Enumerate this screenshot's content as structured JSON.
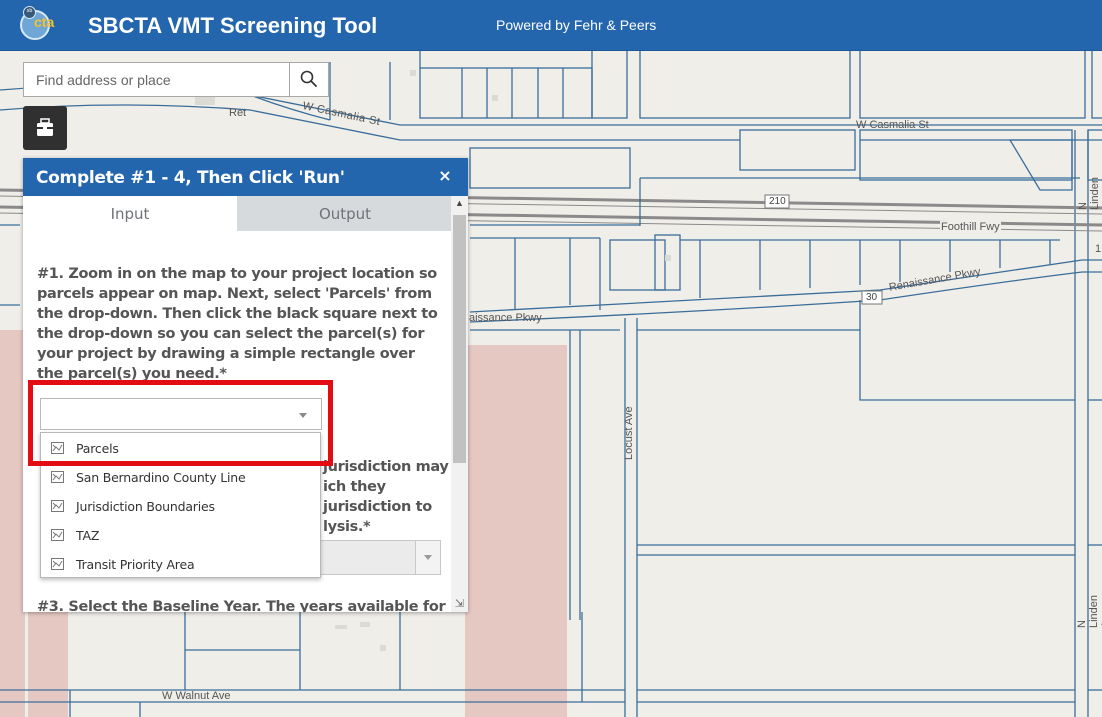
{
  "header": {
    "logo_text": "cta",
    "logo_small": "sb",
    "title": "SBCTA VMT Screening Tool",
    "subtitle": "Powered by Fehr & Peers"
  },
  "search": {
    "placeholder": "Find address or place",
    "value": ""
  },
  "toolbox": {
    "icon": "toolbox-icon"
  },
  "map": {
    "labels": {
      "casmalia_west": "W Casmalia St",
      "casmalia_east": "W Casmalia St",
      "ret": "Ret",
      "foothill": "Foothill Fwy",
      "route_210": "210",
      "route_30": "30",
      "renaissance_east": "Renaissance Pkwy",
      "renaissance_west": "aissance Pkwy",
      "locust": "Locust Ave",
      "linden_north": "N Linden Ave",
      "linden_south": "N Linden Ave",
      "walnut": "W Walnut Ave",
      "edge_1": "1"
    },
    "colors": {
      "background": "#f0eee9",
      "street": "#3a6d99",
      "freeway": "#7a7a7a",
      "zone": "#e7c9c4"
    }
  },
  "panel": {
    "title": "Complete #1 - 4, Then Click 'Run'",
    "close": "×",
    "tabs": [
      {
        "label": "Input",
        "active": true
      },
      {
        "label": "Output",
        "active": false
      }
    ],
    "step1": "#1. Zoom in on the map to your project location so parcels appear on map. Next, select 'Parcels' from the drop-down. Then click the black square next to the drop-down so you can select the parcel(s) for your project by drawing a simple rectangle over the parcel(s) you need.*",
    "layer_select_value": "",
    "step2_lines": [
      "jurisdiction may",
      "ich they",
      "jurisdiction to",
      "lysis.*"
    ],
    "step3": "#3. Select the Baseline Year. The years available for"
  },
  "dropdown": {
    "items": [
      {
        "label": "Parcels",
        "icon": "layer-icon"
      },
      {
        "label": "San Bernardino County Line",
        "icon": "layer-icon"
      },
      {
        "label": "Jurisdiction Boundaries",
        "icon": "layer-icon"
      },
      {
        "label": "TAZ",
        "icon": "layer-icon"
      },
      {
        "label": "Transit Priority Area",
        "icon": "layer-icon"
      }
    ]
  },
  "colors": {
    "header_blue": "#2366ae",
    "highlight_red": "#e20c12"
  }
}
